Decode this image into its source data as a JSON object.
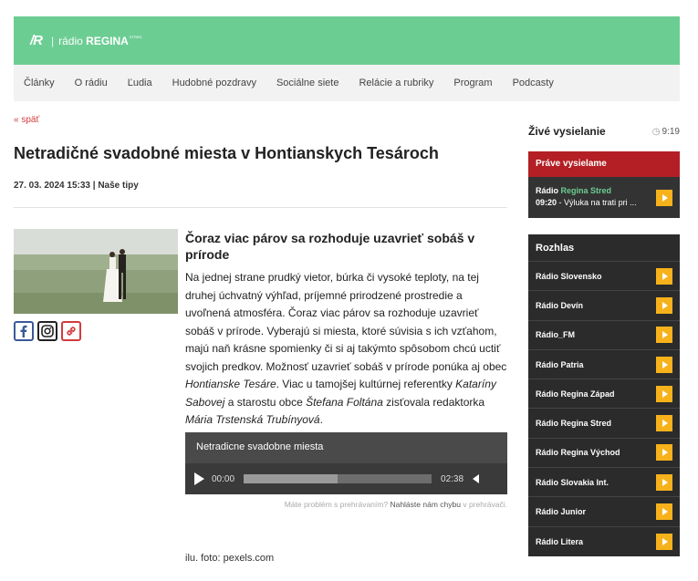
{
  "header": {
    "logo_mark": "/R",
    "logo_prefix": "rádio",
    "logo_brand": "REGINA",
    "logo_tm": "STRED",
    "brand_color": "#6ccd93"
  },
  "nav": [
    "Články",
    "O rádiu",
    "Ľudia",
    "Hudobné pozdravy",
    "Sociálne siete",
    "Relácie a rubriky",
    "Program",
    "Podcasty"
  ],
  "article": {
    "back": "« späť",
    "title": "Netradičné svadobné miesta v Hontianskych Tesároch",
    "date": "27. 03. 2024 15:33",
    "sep": " | ",
    "category": "Naše tipy",
    "subtitle": "Čoraz viac párov sa rozhoduje uzavrieť sobáš v prírode",
    "body_1": "Na jednej strane prudký vietor, búrka či vysoké teploty, na tej druhej úchvatný výhľad, príjemné prirodzené prostredie a uvoľnená atmosféra. Čoraz viac párov sa rozhoduje uzavrieť sobáš v prírode. Vyberajú si miesta, ktoré súvisia s ich vzťahom, majú naň krásne spomienky či si aj takýmto spôsobom chcú uctiť svojich predkov. Možnosť uzavrieť sobáš v prírode ponúka aj obec ",
    "body_em_1": "Hontianske Tesáre",
    "body_2": ". Viac u tamojšej kultúrnej referentky ",
    "body_em_2": "Kataríny Sabovej",
    "body_3": " a starostu obce ",
    "body_em_3": "Štefana Foltána",
    "body_4": " zisťovala redaktorka ",
    "body_em_4": "Mária Trstenská Trubínyová",
    "body_5": ".",
    "caption": "ilu. foto: pexels.com",
    "shares": [
      "facebook-icon",
      "instagram-icon",
      "link-icon"
    ]
  },
  "player": {
    "title": "Netradicne svadobne miesta",
    "current": "00:00",
    "duration": "02:38",
    "buffered_fraction": 0.5,
    "report_prefix": "Máte problém s prehrávaním?",
    "report_link": "Nahláste nám chybu",
    "report_suffix": "v prehrávači."
  },
  "sidebar": {
    "live_title": "Živé vysielanie",
    "live_time": "9:19",
    "now_title": "Práve vysielame",
    "now_station_prefix": "Rádio",
    "now_station": "Regina Stred",
    "now_time": "09:20",
    "now_show": "- Výluka na trati pri ...",
    "rozhlas_title": "Rozhlas",
    "stations": [
      "Rádio Slovensko",
      "Rádio Devín",
      "Rádio_FM",
      "Rádio Patria",
      "Rádio Regina Západ",
      "Rádio Regina Stred",
      "Rádio Regina Východ",
      "Rádio Slovakia Int.",
      "Rádio Junior",
      "Rádio Litera"
    ],
    "accent": "#b31f24",
    "play_color": "#f7b21b"
  }
}
